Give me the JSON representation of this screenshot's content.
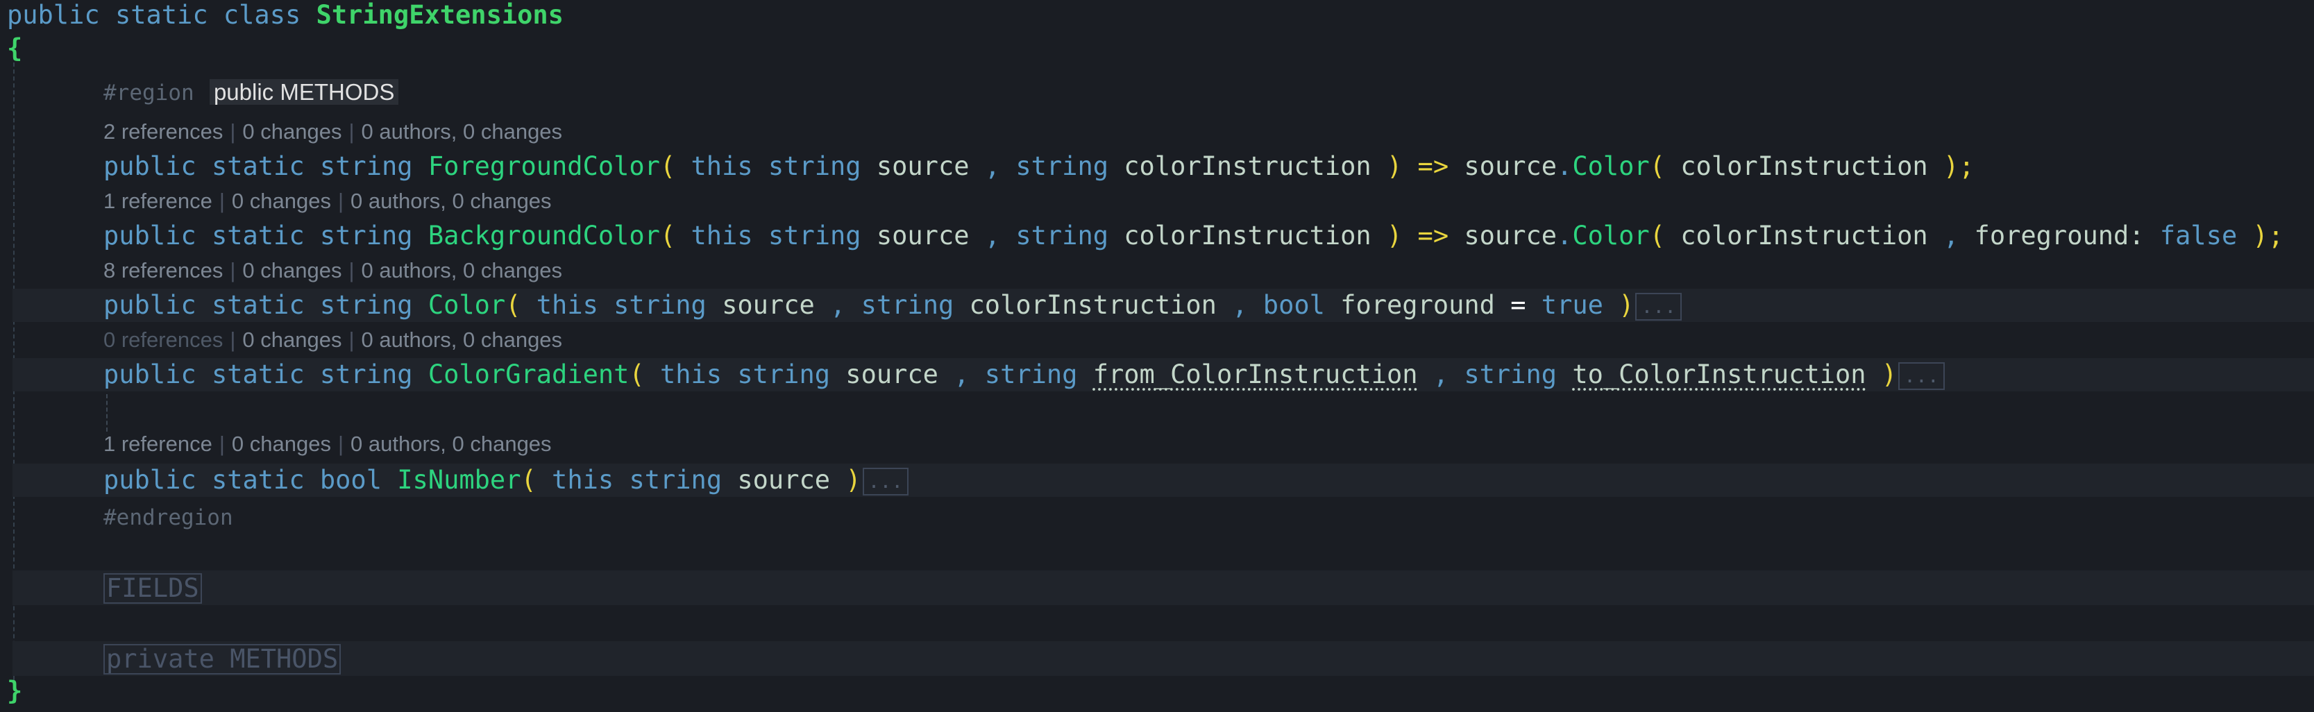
{
  "code": {
    "class_decl": {
      "kw1": "public",
      "kw2": "static",
      "kw3": "class",
      "name": "StringExtensions"
    },
    "open_brace": "{",
    "close_brace": "}",
    "region": {
      "directive": "#region",
      "name": "public METHODS",
      "end": "#endregion"
    },
    "methods": [
      {
        "lens": {
          "refs": "2 references",
          "changes": "0 changes",
          "authors": "0 authors, 0 changes"
        },
        "kw1": "public",
        "kw2": "static",
        "ret": "string",
        "name": "ForegroundColor",
        "p_this": "this",
        "p1_type": "string",
        "p1_name": "source",
        "comma": ",",
        "p2_type": "string",
        "p2_name": "colorInstruction",
        "arrow": "=>",
        "call_target": "source",
        "call_name": "Color",
        "arg1": "colorInstruction",
        "end": ";"
      },
      {
        "lens": {
          "refs": "1 reference",
          "changes": "0 changes",
          "authors": "0 authors, 0 changes"
        },
        "kw1": "public",
        "kw2": "static",
        "ret": "string",
        "name": "BackgroundColor",
        "p_this": "this",
        "p1_type": "string",
        "p1_name": "source",
        "comma": ",",
        "p2_type": "string",
        "p2_name": "colorInstruction",
        "arrow": "=>",
        "call_target": "source",
        "call_name": "Color",
        "arg1": "colorInstruction",
        "arg2_name": "foreground:",
        "arg2_val": "false",
        "end": ";"
      },
      {
        "lens": {
          "refs": "8 references",
          "changes": "0 changes",
          "authors": "0 authors, 0 changes"
        },
        "kw1": "public",
        "kw2": "static",
        "ret": "string",
        "name": "Color",
        "p_this": "this",
        "p1_type": "string",
        "p1_name": "source",
        "comma": ",",
        "p2_type": "string",
        "p2_name": "colorInstruction",
        "p3_type": "bool",
        "p3_name": "foreground",
        "eq": "=",
        "p3_val": "true",
        "fold": "..."
      },
      {
        "lens": {
          "refs": "0 references",
          "changes": "0 changes",
          "authors": "0 authors, 0 changes"
        },
        "kw1": "public",
        "kw2": "static",
        "ret": "string",
        "name": "ColorGradient",
        "p_this": "this",
        "p1_type": "string",
        "p1_name": "source",
        "comma": ",",
        "p2_type": "string",
        "p2_name": "from_ColorInstruction",
        "p3_type": "string",
        "p3_name": "to_ColorInstruction",
        "fold": "..."
      },
      {
        "lens": {
          "refs": "1 reference",
          "changes": "0 changes",
          "authors": "0 authors, 0 changes"
        },
        "kw1": "public",
        "kw2": "static",
        "ret": "bool",
        "name": "IsNumber",
        "p_this": "this",
        "p1_type": "string",
        "p1_name": "source",
        "fold": "..."
      }
    ],
    "collapsed_regions": [
      "FIELDS",
      "private METHODS"
    ]
  },
  "colors": {
    "background": "#1a1d23",
    "keyword": "#5b9bc8",
    "type_name": "#3fd46a",
    "method": "#2dd47f",
    "identifier": "#c3d6c9",
    "paren": "#e9d53e",
    "codelens": "#7d8794"
  }
}
